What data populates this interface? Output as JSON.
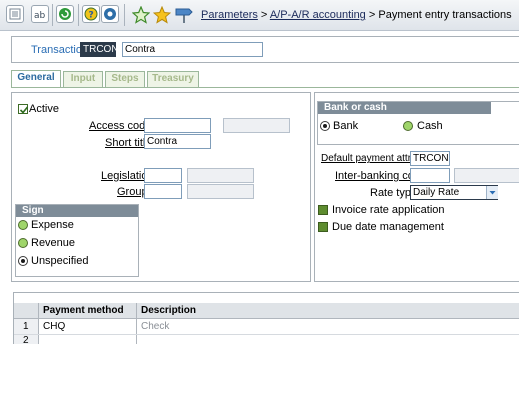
{
  "toolbar": {
    "icons": [
      "list-icon",
      "text-ab-icon",
      "refresh-icon",
      "help-icon",
      "settings-icon",
      "star-outline-icon",
      "star-icon",
      "signpost-icon"
    ]
  },
  "breadcrumb": {
    "item1": "Parameters",
    "sep1": ">",
    "item2": "A/P-A/R accounting",
    "sep2": ">",
    "item3": "Payment entry transactions"
  },
  "header": {
    "transaction_label": "Transaction",
    "transaction_code": "TRCON",
    "transaction_desc": "Contra"
  },
  "tabs": [
    {
      "label": "General",
      "active": true
    },
    {
      "label": "Input",
      "active": false
    },
    {
      "label": "Steps",
      "active": false
    },
    {
      "label": "Treasury",
      "active": false
    }
  ],
  "general": {
    "active_label": "Active",
    "active_checked": true,
    "access_code_label": "Access code",
    "access_code_value": "",
    "short_title_label": "Short title",
    "short_title_value": "Contra",
    "legislation_label": "Legislation",
    "legislation_value": "",
    "group_label": "Group",
    "group_value": ""
  },
  "sign": {
    "title": "Sign",
    "options": [
      "Expense",
      "Revenue",
      "Unspecified"
    ],
    "selected": "Unspecified"
  },
  "bank_or_cash": {
    "title": "Bank or cash",
    "options": [
      "Bank",
      "Cash"
    ],
    "selected": "Bank"
  },
  "right": {
    "default_payment_label": "Default payment attri...",
    "default_payment_value": "TRCON",
    "inter_banking_label": "Inter-banking code",
    "inter_banking_value": "",
    "rate_type_label": "Rate type",
    "rate_type_value": "Daily Rate",
    "invoice_rate_label": "Invoice rate application",
    "due_date_label": "Due date management"
  },
  "grid": {
    "columns": [
      "Payment method",
      "Description"
    ],
    "rows": [
      {
        "num": "1",
        "method": "CHQ",
        "description": "Check"
      },
      {
        "num": "2",
        "method": "",
        "description": ""
      }
    ]
  },
  "colors": {
    "link_blue": "#2a6db4",
    "group_header": "#7e8c98",
    "radio_green": "#9fd56a"
  }
}
